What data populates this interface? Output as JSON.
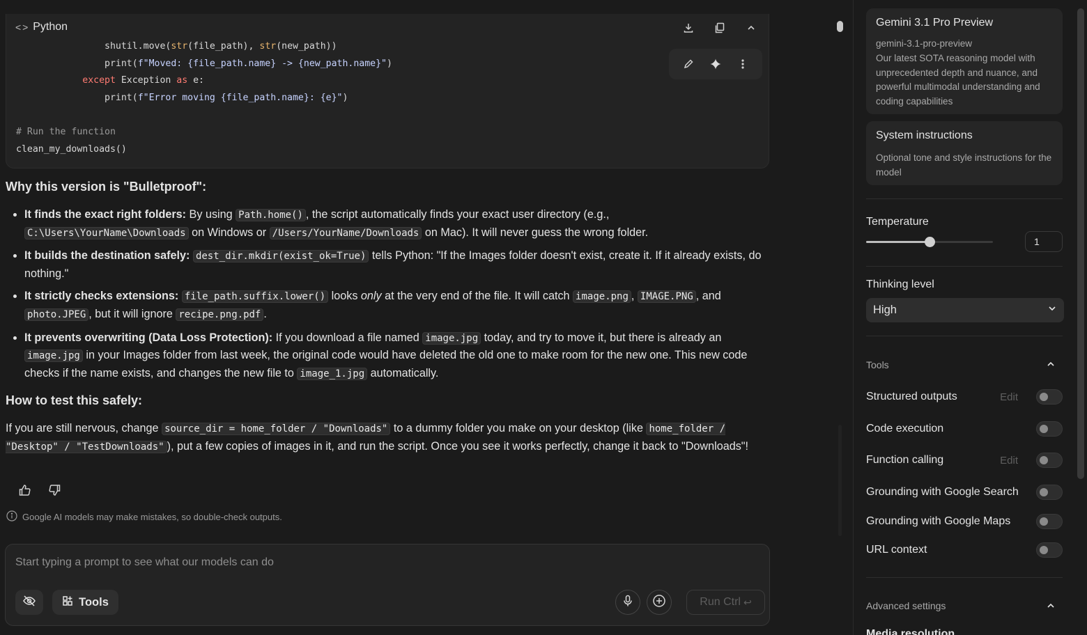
{
  "code_block": {
    "language": "Python",
    "lines": [
      {
        "indent": 4,
        "parts": [
          [
            "plain",
            "shutil.move("
          ],
          [
            "bi",
            "str"
          ],
          [
            "plain",
            "(file_path), "
          ],
          [
            "bi",
            "str"
          ],
          [
            "plain",
            "(new_path))"
          ]
        ]
      },
      {
        "indent": 4,
        "parts": [
          [
            "plain",
            "print("
          ],
          [
            "str",
            "f\"Moved: {file_path.name} -> {new_path.name}\""
          ],
          [
            "plain",
            ")"
          ]
        ]
      },
      {
        "indent": 3,
        "parts": [
          [
            "kw",
            "except"
          ],
          [
            "plain",
            " Exception "
          ],
          [
            "kw",
            "as"
          ],
          [
            "plain",
            " e:"
          ]
        ]
      },
      {
        "indent": 4,
        "parts": [
          [
            "plain",
            "print("
          ],
          [
            "str",
            "f\"Error moving {file_path.name}: {e}\""
          ],
          [
            "plain",
            ")"
          ]
        ]
      },
      {
        "indent": 0,
        "parts": [
          [
            "plain",
            ""
          ]
        ]
      },
      {
        "indent": 0,
        "parts": [
          [
            "cm",
            "# Run the function"
          ]
        ]
      },
      {
        "indent": 0,
        "parts": [
          [
            "plain",
            "clean_my_downloads()"
          ]
        ]
      }
    ]
  },
  "sections": {
    "why_title": "Why this version is \"Bulletproof\":",
    "how_title": "How to test this safely:"
  },
  "bullets": [
    [
      [
        "b",
        "It finds the exact right folders:"
      ],
      [
        "t",
        " By using "
      ],
      [
        "c",
        "Path.home()"
      ],
      [
        "t",
        ", the script automatically finds your exact user directory (e.g., "
      ],
      [
        "c",
        "C:\\Users\\YourName\\Downloads"
      ],
      [
        "t",
        " on Windows or "
      ],
      [
        "c",
        "/Users/YourName/Downloads"
      ],
      [
        "t",
        " on Mac). It will never guess the wrong folder."
      ]
    ],
    [
      [
        "b",
        "It builds the destination safely:"
      ],
      [
        "t",
        " "
      ],
      [
        "c",
        "dest_dir.mkdir(exist_ok=True)"
      ],
      [
        "t",
        " tells Python: \"If the Images folder doesn't exist, create it. If it already exists, do nothing.\""
      ]
    ],
    [
      [
        "b",
        "It strictly checks extensions:"
      ],
      [
        "t",
        " "
      ],
      [
        "c",
        "file_path.suffix.lower()"
      ],
      [
        "t",
        " looks "
      ],
      [
        "i",
        "only"
      ],
      [
        "t",
        " at the very end of the file. It will catch "
      ],
      [
        "c",
        "image.png"
      ],
      [
        "t",
        ", "
      ],
      [
        "c",
        "IMAGE.PNG"
      ],
      [
        "t",
        ", and "
      ],
      [
        "c",
        "photo.JPEG"
      ],
      [
        "t",
        ", but it will ignore "
      ],
      [
        "c",
        "recipe.png.pdf"
      ],
      [
        "t",
        "."
      ]
    ],
    [
      [
        "b",
        "It prevents overwriting (Data Loss Protection):"
      ],
      [
        "t",
        " If you download a file named "
      ],
      [
        "c",
        "image.jpg"
      ],
      [
        "t",
        " today, and try to move it, but there is already an "
      ],
      [
        "c",
        "image.jpg"
      ],
      [
        "t",
        " in your Images folder from last week, the original code would have deleted the old one to make room for the new one. This new code checks if the name exists, and changes the new file to "
      ],
      [
        "c",
        "image_1.jpg"
      ],
      [
        "t",
        " automatically."
      ]
    ]
  ],
  "test_paragraph": [
    [
      "t",
      "If you are still nervous, change "
    ],
    [
      "c",
      "source_dir = home_folder / \"Downloads\""
    ],
    [
      "t",
      " to a dummy folder you make on your desktop (like "
    ],
    [
      "c",
      "home_folder / \"Desktop\" / \"TestDownloads\""
    ],
    [
      "t",
      "), put a few copies of images in it, and run the script. Once you see it works perfectly, change it back to \"Downloads\"!"
    ]
  ],
  "disclaimer": "Google AI models may make mistakes, so double-check outputs.",
  "prompt": {
    "placeholder": "Start typing a prompt to see what our models can do",
    "tools_label": "Tools",
    "run_label": "Run Ctrl",
    "run_icon": "return-arrow-icon"
  },
  "panel": {
    "model": {
      "name": "Gemini 3.1 Pro Preview",
      "id": "gemini-3.1-pro-preview",
      "description": "Our latest SOTA reasoning model with unprecedented depth and nuance, and powerful multimodal understanding and coding capabilities"
    },
    "system_instructions": {
      "title": "System instructions",
      "description": "Optional tone and style instructions for the model"
    },
    "temperature": {
      "label": "Temperature",
      "value": "1",
      "level_fraction": 0.5
    },
    "thinking": {
      "label": "Thinking level",
      "value": "High"
    },
    "tools_header": "Tools",
    "tools": [
      {
        "name": "Structured outputs",
        "edit": "Edit",
        "enabled": false
      },
      {
        "name": "Code execution",
        "edit": "",
        "enabled": false
      },
      {
        "name": "Function calling",
        "edit": "Edit",
        "enabled": false
      },
      {
        "name": "Grounding with Google Search",
        "edit": "",
        "enabled": false
      },
      {
        "name": "Grounding with Google Maps",
        "edit": "",
        "enabled": false
      },
      {
        "name": "URL context",
        "edit": "",
        "enabled": false
      }
    ],
    "advanced_header": "Advanced settings",
    "media_resolution_partial": "Media resolution"
  },
  "colors": {
    "background": "#1b1b1b",
    "card": "#262626",
    "keyword": "#ff7b72",
    "builtin": "#e6b36d",
    "string": "#c7d3ff"
  }
}
